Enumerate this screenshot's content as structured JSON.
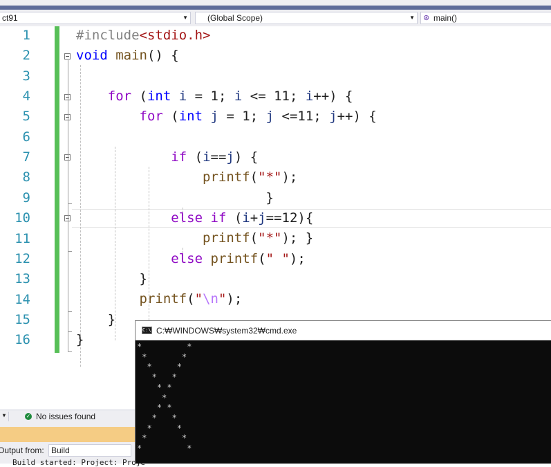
{
  "navbar": {
    "project": "ct91",
    "scope": "(Global Scope)",
    "member": "main()"
  },
  "editor": {
    "line_numbers": [
      "1",
      "2",
      "3",
      "4",
      "5",
      "6",
      "7",
      "8",
      "9",
      "10",
      "11",
      "12",
      "13",
      "14",
      "15",
      "16"
    ],
    "code_lines": [
      "#include<stdio.h>",
      "void main() {",
      "",
      "    for (int i = 1; i <= 11; i++) {",
      "        for (int j = 1; j <=11; j++) {",
      "",
      "            if (i==j) {",
      "                printf(\"*\");",
      "                        }",
      "            else if (i+j==12){",
      "                printf(\"*\"); }",
      "            else printf(\" \");",
      "        }",
      "        printf(\"\\n\");",
      "    }",
      "}"
    ]
  },
  "statusbar": {
    "issues": "No issues found"
  },
  "output": {
    "from_label": "Output from:",
    "source": "Build",
    "text": "Build started: Project: Proje"
  },
  "console": {
    "title": "C:₩WINDOWS₩system32₩cmd.exe",
    "icon_text": "C:\\",
    "lines": [
      "*         *",
      " *       *",
      "  *     *",
      "   *   *",
      "    * *",
      "     *",
      "    * *",
      "   *   *",
      "  *     *",
      " *       *",
      "*         *"
    ]
  },
  "colors": {
    "keyword": "#0000ff",
    "control_keyword": "#8f08c4",
    "string": "#a31515",
    "function": "#74531f",
    "variable": "#1f377f",
    "line_number": "#2b91af",
    "change_bar": "#57bf57",
    "output_tab": "#f5cc84",
    "console_bg": "#0c0c0c"
  }
}
